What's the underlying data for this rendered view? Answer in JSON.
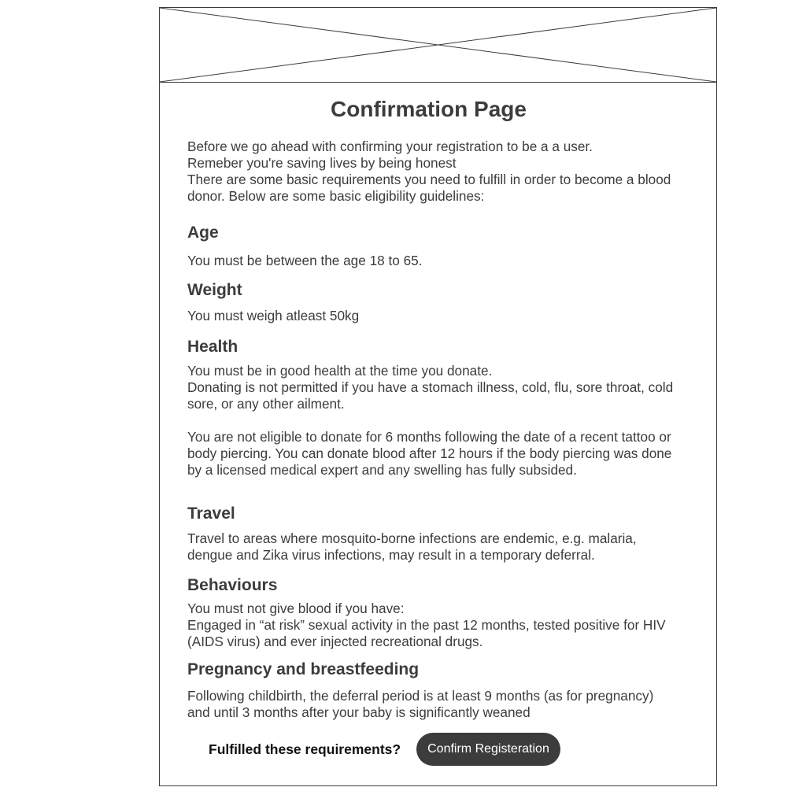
{
  "page": {
    "title": "Confirmation Page"
  },
  "intro": {
    "line1": "Before we go ahead with confirming your registration to be a a user.",
    "line2": "Remeber you're saving lives by being honest",
    "line3": "There are some basic requirements you need to fulfill in order to become a blood donor. Below are some basic eligibility guidelines:"
  },
  "sections": {
    "age": {
      "heading": "Age",
      "text": "You must be between the age 18 to 65."
    },
    "weight": {
      "heading": "Weight",
      "text": "You must weigh atleast 50kg"
    },
    "health": {
      "heading": "Health",
      "text1": "You must be in good health at the time you donate.",
      "text2": "Donating is not permitted if you have a stomach illness, cold, flu, sore throat, cold sore, or any other ailment.",
      "text3": "You are not eligible to donate for 6 months following the date of a recent tattoo or body piercing. You can donate blood after 12 hours if the body piercing was done by a licensed medical expert and any swelling has fully subsided."
    },
    "travel": {
      "heading": "Travel",
      "text": "Travel to areas where mosquito-borne infections are endemic, e.g. malaria, dengue and Zika virus infections, may result in a temporary deferral."
    },
    "behaviours": {
      "heading": "Behaviours",
      "text1": "You must not give blood if you have:",
      "text2": "Engaged in “at risk” sexual activity in the past 12 months, tested positive for HIV (AIDS virus) and ever injected recreational drugs."
    },
    "pregnancy": {
      "heading": "Pregnancy and breastfeeding",
      "text": "Following childbirth, the deferral period is at least 9 months (as for pregnancy) and until 3 months after your baby is significantly weaned"
    }
  },
  "footer": {
    "question": "Fulfilled these requirements?",
    "confirm_label": "Confirm Registeration"
  }
}
